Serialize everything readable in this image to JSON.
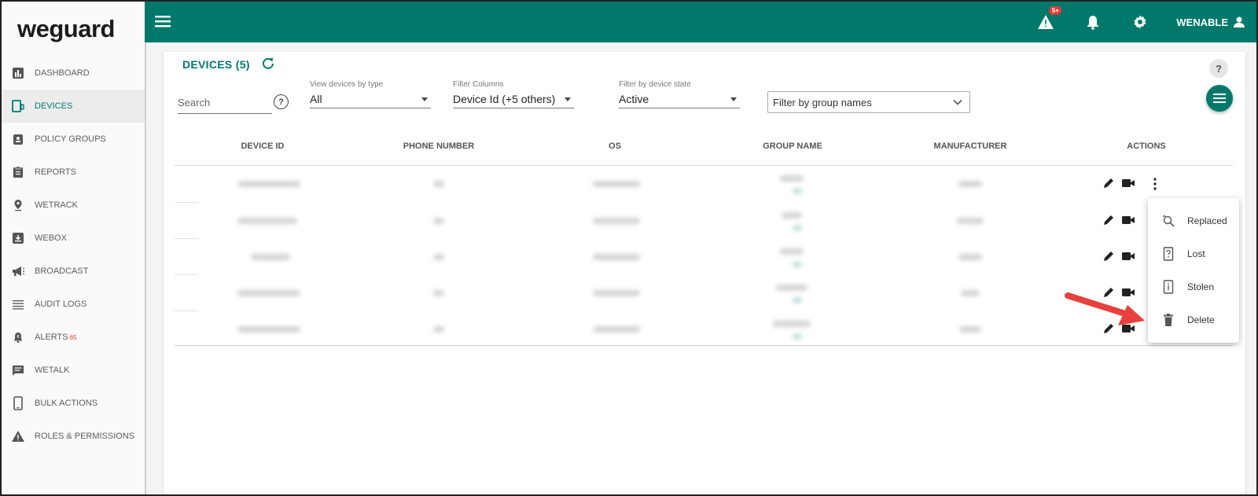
{
  "app": {
    "logo": "weguard"
  },
  "sidebar": {
    "items": [
      {
        "label": "DASHBOARD",
        "icon": "bar-chart-icon"
      },
      {
        "label": "DEVICES",
        "icon": "device-icon"
      },
      {
        "label": "POLICY GROUPS",
        "icon": "badge-icon"
      },
      {
        "label": "REPORTS",
        "icon": "clipboard-icon"
      },
      {
        "label": "WETRACK",
        "icon": "location-pin-icon"
      },
      {
        "label": "WEBOX",
        "icon": "inbox-download-icon"
      },
      {
        "label": "BROADCAST",
        "icon": "megaphone-icon"
      },
      {
        "label": "AUDIT LOGS",
        "icon": "list-icon"
      },
      {
        "label": "ALERTS",
        "icon": "alarm-icon",
        "badge": "65"
      },
      {
        "label": "WETALK",
        "icon": "chat-icon"
      },
      {
        "label": "BULK ACTIONS",
        "icon": "phone-icon"
      },
      {
        "label": "ROLES & PERMISSIONS",
        "icon": "warning-icon"
      }
    ]
  },
  "topbar": {
    "alert_badge": "5+",
    "user_name": "WENABLE",
    "colors": {
      "primary": "#00796b",
      "badge": "#e53935"
    }
  },
  "devices": {
    "title": "DEVICES",
    "count": "(5)",
    "help": "?",
    "search": {
      "placeholder": "Search",
      "help": "?"
    },
    "filters": {
      "type": {
        "label": "View devices by type",
        "value": "All"
      },
      "columns": {
        "label": "Filter Columns",
        "value": "Device Id (+5 others)"
      },
      "state": {
        "label": "Filter by device state",
        "value": "Active"
      },
      "group": {
        "placeholder": "Filter by group names"
      }
    },
    "columns": [
      "DEVICE ID",
      "PHONE NUMBER",
      "OS",
      "GROUP NAME",
      "MANUFACTURER",
      "ACTIONS"
    ],
    "row_count": 5
  },
  "action_menu": {
    "items": [
      {
        "label": "Replaced",
        "icon": "replaced-search-icon"
      },
      {
        "label": "Lost",
        "icon": "lost-device-icon"
      },
      {
        "label": "Stolen",
        "icon": "stolen-device-icon"
      },
      {
        "label": "Delete",
        "icon": "trash-icon"
      }
    ]
  }
}
